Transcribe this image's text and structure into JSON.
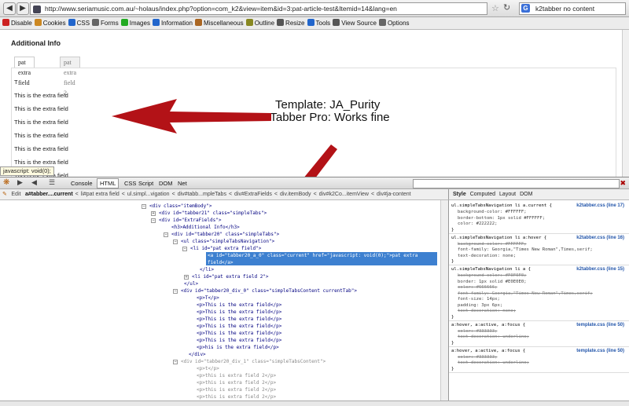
{
  "browser": {
    "url": "http://www.seriamusic.com.au/~holaus/index.php?option=com_k2&view=item&id=3:pat-article-test&Itemid=14&lang=en",
    "search_text": "k2tabber no content",
    "search_engine_glyph": "G"
  },
  "webdev_toolbar": {
    "items": [
      "Disable",
      "Cookies",
      "CSS",
      "Forms",
      "Images",
      "Information",
      "Miscellaneous",
      "Outline",
      "Resize",
      "Tools",
      "View Source",
      "Options"
    ]
  },
  "page": {
    "heading": "Additional Info",
    "tabs": [
      "pat extra field",
      "pat extra field 2"
    ],
    "lines": [
      "T",
      "This is the extra field",
      "This is the extra field",
      "This is the extra field",
      "This is the extra field",
      "This is the extra field",
      "This is the extra field",
      "This is the extra field"
    ],
    "statusbar_text": "javascript: void(0);"
  },
  "annotation": {
    "line1": "Template: JA_Purity",
    "line2": "K2Tabber Pro: Works fine",
    "arrow_color": "#b31217"
  },
  "firebug": {
    "tabs": [
      "Console",
      "HTML",
      "CSS",
      "Script",
      "DOM",
      "Net"
    ],
    "active_tab": "HTML",
    "edit_label": "Edit",
    "breadcrumbs": [
      "a#tabber....current",
      "li#pat extra field",
      "ul.simpl...vigation",
      "div#tabb...mpleTabs",
      "div#ExtraFields",
      "div.itemBody",
      "div#k2Co...itemView",
      "div#ja-content"
    ],
    "side_tabs": [
      "Style",
      "Computed",
      "Layout",
      "DOM"
    ],
    "html_lines": [
      "<div class=\"itemBody\">",
      "<div id=\"tabber21\" class=\"simpleTabs\">",
      "<div id=\"ExtraFields\">",
      "<h3>Additional Info</h3>",
      "<div id=\"tabber20\" class=\"simpleTabs\">",
      "<ul class=\"simpleTabsNavigation\">",
      "<li id=\"pat extra field\">",
      "<a id=\"tabber20_a_0\" class=\"current\" href=\"javascript: void(0);\">pat extra",
      "field</a>",
      "</li>",
      "<li id=\"pat extra field 2\">",
      "</ul>",
      "<div id=\"tabber20_div_0\" class=\"simpleTabsContent currentTab\">",
      "<p>T</p>",
      "<p>This is the extra field</p>",
      "<p>This is the extra field</p>",
      "<p>This is the extra field</p>",
      "<p>This is the extra field</p>",
      "<p>This is the extra field</p>",
      "<p>This is the extra field</p>",
      "<p>his is the extra field</p>",
      "</div>",
      "<div id=\"tabber20_div_1\" class=\"simpleTabsContent\">",
      "<p>t</p>",
      "<p>this is extra field 2</p>",
      "<p>this is extra field 2</p>",
      "<p>this is extra field 2</p>",
      "<p>this is extra field 2</p>",
      "<p>this is extra field 2</p>"
    ],
    "style_rules": [
      {
        "selector": "ul.simpleTabsNavigation li a.current {",
        "source": "k2tabber.css (line 17)",
        "props": [
          "background-color: #FFFFFF;",
          "border-bottom: 1px solid #FFFFFF;",
          "color: #222222;"
        ],
        "struck": []
      },
      {
        "selector": "ul.simpleTabsNavigation li a:hover {",
        "source": "k2tabber.css (line 16)",
        "props": [
          "background-color: #FFFFFF;",
          "font-family: Georgia,\"Times New Roman\",Times,serif;",
          "text-decoration: none;"
        ],
        "struck": [
          0
        ]
      },
      {
        "selector": "ul.simpleTabsNavigation li a {",
        "source": "k2tabber.css (line 15)",
        "props": [
          "background-color: #F0F0F0;",
          "border: 1px solid #E0E0E0;",
          "color: #666666;",
          "font-family: Georgia,\"Times New Roman\",Times,serif;",
          "font-size: 14px;",
          "padding: 3px 6px;",
          "text-decoration: none;"
        ],
        "struck": [
          0,
          2,
          3,
          6
        ]
      },
      {
        "selector": "a:hover, a:active, a:focus {",
        "source": "template.css (line 50)",
        "props": [
          "color: #333333;",
          "text-decoration: underline;"
        ],
        "struck": [
          0,
          1
        ]
      },
      {
        "selector": "a:hover, a:active, a:focus {",
        "source": "template.css (line 50)",
        "props": [
          "color: #333333;",
          "text-decoration: underline;"
        ],
        "struck": [
          0,
          1
        ]
      }
    ]
  }
}
